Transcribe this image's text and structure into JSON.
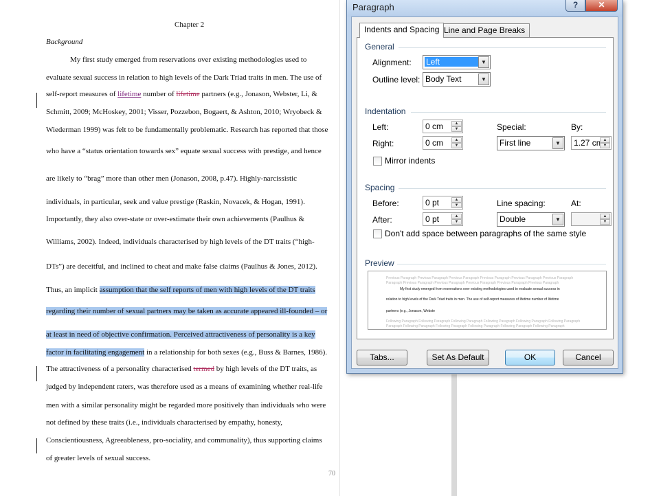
{
  "document": {
    "chapter": "Chapter 2",
    "heading": "Background",
    "page_number": "70",
    "lines": [
      {
        "segments": [
          {
            "t": "My first study emerged from reservations over existing methodologies used to"
          }
        ]
      },
      {
        "segments": [
          {
            "t": "evaluate sexual success in relation to high levels of the Dark Triad traits in men. The use of"
          }
        ]
      },
      {
        "segments": [
          {
            "t": "self-report measures of "
          },
          {
            "t": "lifetime",
            "s": "ins"
          },
          {
            "t": " number of "
          },
          {
            "t": "lifetime",
            "s": "del"
          },
          {
            "t": " partners (e.g., Jonason, Webster, Li, &"
          }
        ]
      },
      {
        "segments": [
          {
            "t": "Schmitt, 2009; McHoskey, 2001; Visser, Pozzebon, Bogaert, & Ashton, 2010; Wryobeck &"
          }
        ]
      },
      {
        "segments": [
          {
            "t": "Wiederman 1999) was felt to be fundamentally problematic. Research has reported that those"
          }
        ]
      },
      {
        "segments": [
          {
            "t": "who have a “status orientation towards sex” equate sexual success with prestige, and hence"
          }
        ]
      },
      {
        "segments": [
          {
            "t": "are likely to “brag” more than other men (Jonason, 2008, p.47). Highly-narcissistic"
          }
        ]
      },
      {
        "segments": [
          {
            "t": "individuals, in particular, seek and value prestige (Raskin, Novacek, & Hogan, 1991)."
          }
        ]
      },
      {
        "segments": [
          {
            "t": "Importantly, they also over-state or over-estimate their own achievements (Paulhus &"
          }
        ]
      },
      {
        "segments": [
          {
            "t": "Williams, 2002). Indeed, individuals characterised by high levels of the DT traits (“high-"
          }
        ]
      },
      {
        "segments": [
          {
            "t": "DTs”) are deceitful, and inclined to cheat and make false claims (Paulhus & Jones, 2012)."
          }
        ]
      },
      {
        "segments": [
          {
            "t": "Thus, an implicit "
          },
          {
            "t": "assumption that the self reports of men with high levels of the DT traits",
            "s": "hl"
          }
        ]
      },
      {
        "segments": [
          {
            "t": "regarding their number of sexual partners may be taken as accurate appeared ill-founded – or",
            "s": "hl"
          }
        ]
      },
      {
        "segments": [
          {
            "t": "at least in need of objective confirmation. Perceived attractiveness of personality is a key",
            "s": "hl"
          }
        ]
      },
      {
        "segments": [
          {
            "t": "factor in facilitating engagement",
            "s": "hl"
          },
          {
            "t": " in a relationship for both sexes (e.g., Buss & Barnes, 1986)."
          }
        ]
      },
      {
        "segments": [
          {
            "t": "The attractiveness of a personality characterised "
          },
          {
            "t": "termed",
            "s": "del"
          },
          {
            "t": " by high levels of the DT traits, as"
          }
        ]
      },
      {
        "segments": [
          {
            "t": "judged by independent raters, was therefore used as a means of examining whether real-life"
          }
        ]
      },
      {
        "segments": [
          {
            "t": "men with a similar personality might be regarded more positively than individuals who were"
          }
        ]
      },
      {
        "segments": [
          {
            "t": "not defined by these traits (i.e., individuals characterised by empathy, honesty,"
          }
        ]
      },
      {
        "segments": [
          {
            "t": "Conscientiousness, Agreeableness, pro-sociality, and communality), thus supporting claims"
          }
        ]
      },
      {
        "segments": [
          {
            "t": "of greater levels of sexual success."
          }
        ]
      }
    ]
  },
  "dialog": {
    "title": "Paragraph",
    "help_label": "?",
    "close_label": "✕",
    "tabs": [
      {
        "label": "Indents and Spacing",
        "active": true
      },
      {
        "label": "Line and Page Breaks",
        "active": false
      }
    ],
    "general": {
      "header": "General",
      "alignment_label": "Alignment:",
      "alignment_value": "Left",
      "outline_label": "Outline level:",
      "outline_value": "Body Text"
    },
    "indentation": {
      "header": "Indentation",
      "left_label": "Left:",
      "left_value": "0 cm",
      "right_label": "Right:",
      "right_value": "0 cm",
      "special_label": "Special:",
      "special_value": "First line",
      "by_label": "By:",
      "by_value": "1.27 cm",
      "mirror_label": "Mirror indents"
    },
    "spacing": {
      "header": "Spacing",
      "before_label": "Before:",
      "before_value": "0 pt",
      "after_label": "After:",
      "after_value": "0 pt",
      "line_spacing_label": "Line spacing:",
      "line_spacing_value": "Double",
      "at_label": "At:",
      "at_value": "",
      "dont_add_label": "Don't add space between paragraphs of the same style"
    },
    "preview": {
      "header": "Preview",
      "prev_1": "Previous Paragraph Previous Paragraph Previous Paragraph Previous Paragraph Previous Paragraph Previous Paragraph",
      "prev_2": "Paragraph Previous Paragraph Previous Paragraph Previous Paragraph Previous Paragraph Previous Paragraph",
      "sample_1": "My first study emerged from reservations over existing methodologies used to evaluate sexual success in",
      "sample_2": "relation to high levels of the Dark Triad traits in men. The use of self-report measures of lifetime number of lifetime",
      "sample_3": "partners (e.g., Jonason, Webste",
      "next_1": "Following Paragraph Following Paragraph Following Paragraph Following Paragraph Following Paragraph Following Paragraph",
      "next_2": "Paragraph Following Paragraph Following Paragraph Following Paragraph Following Paragraph Following Paragraph"
    },
    "buttons": {
      "tabs": "Tabs...",
      "set_default": "Set As Default",
      "ok": "OK",
      "cancel": "Cancel"
    }
  }
}
